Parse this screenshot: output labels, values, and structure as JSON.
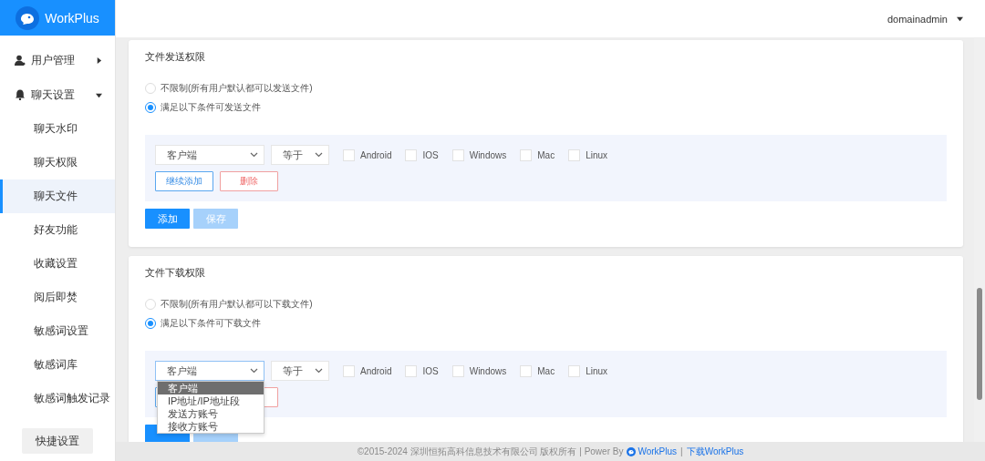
{
  "brand": {
    "name": "WorkPlus"
  },
  "header": {
    "user": "domainadmin"
  },
  "sidebar": {
    "items": [
      {
        "label": "用户管理",
        "expanded": false
      },
      {
        "label": "聊天设置",
        "expanded": true,
        "children": [
          {
            "label": "聊天水印",
            "selected": false
          },
          {
            "label": "聊天权限",
            "selected": false
          },
          {
            "label": "聊天文件",
            "selected": true
          },
          {
            "label": "好友功能",
            "selected": false
          },
          {
            "label": "收藏设置",
            "selected": false
          },
          {
            "label": "阅后即焚",
            "selected": false
          },
          {
            "label": "敏感词设置",
            "selected": false
          },
          {
            "label": "敏感词库",
            "selected": false
          },
          {
            "label": "敏感词触发记录",
            "selected": false
          }
        ]
      }
    ],
    "quick_button": "快捷设置"
  },
  "sections": [
    {
      "title": "文件发送权限",
      "options": [
        {
          "label": "不限制(所有用户默认都可以发送文件)",
          "selected": false
        },
        {
          "label": "满足以下条件可发送文件",
          "selected": true
        }
      ],
      "condition": {
        "field": "客户端",
        "operator": "等于",
        "platforms": [
          {
            "label": "Android",
            "checked": false
          },
          {
            "label": "IOS",
            "checked": false
          },
          {
            "label": "Windows",
            "checked": false
          },
          {
            "label": "Mac",
            "checked": false
          },
          {
            "label": "Linux",
            "checked": false
          }
        ]
      },
      "row_buttons": [
        {
          "kind": "continue",
          "label": "继续添加"
        },
        {
          "kind": "delete",
          "label": "删除"
        }
      ],
      "actions": [
        {
          "kind": "primary",
          "label": "添加"
        },
        {
          "kind": "disabled",
          "label": "保存"
        }
      ]
    },
    {
      "title": "文件下载权限",
      "options": [
        {
          "label": "不限制(所有用户默认都可以下载文件)",
          "selected": false
        },
        {
          "label": "满足以下条件可下载文件",
          "selected": true
        }
      ],
      "condition": {
        "field": "客户端",
        "operator": "等于",
        "platforms": [
          {
            "label": "Android",
            "checked": false
          },
          {
            "label": "IOS",
            "checked": false
          },
          {
            "label": "Windows",
            "checked": false
          },
          {
            "label": "Mac",
            "checked": false
          },
          {
            "label": "Linux",
            "checked": false
          }
        ],
        "dropdown": [
          {
            "label": "客户端",
            "selected": true
          },
          {
            "label": "IP地址/IP地址段",
            "selected": false
          },
          {
            "label": "发送方账号",
            "selected": false
          },
          {
            "label": "接收方账号",
            "selected": false
          }
        ]
      },
      "row_buttons": [
        {
          "kind": "continue"
        },
        {
          "kind": "delete"
        }
      ],
      "actions": [
        {
          "kind": "primary"
        },
        {
          "kind": "disabled"
        }
      ]
    }
  ],
  "footer": {
    "copyright": "©2015-2024 深圳恒拓高科信息技术有限公司 版权所有 | Power By",
    "brand": "WorkPlus",
    "separator": "|",
    "download": "下载WorkPlus"
  }
}
